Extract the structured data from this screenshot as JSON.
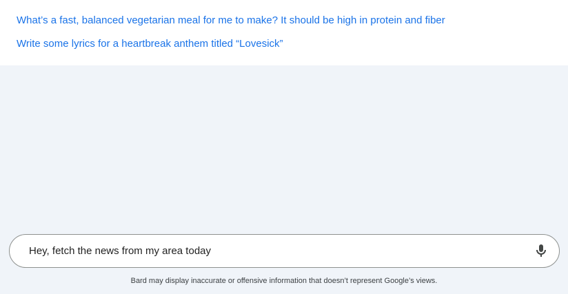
{
  "suggestions": [
    {
      "label": "What’s a fast, balanced vegetarian meal for me to make? It should be high in protein and fiber"
    },
    {
      "label": "Write some lyrics for a heartbreak anthem titled “Lovesick”"
    }
  ],
  "prompt": {
    "value": "Hey, fetch the news from my area today",
    "mic_icon": "microphone-icon"
  },
  "disclaimer": "Bard may display inaccurate or offensive information that doesn’t represent Google’s views.",
  "colors": {
    "link": "#1a73e8",
    "background": "#f0f4f9",
    "panel": "#ffffff"
  }
}
